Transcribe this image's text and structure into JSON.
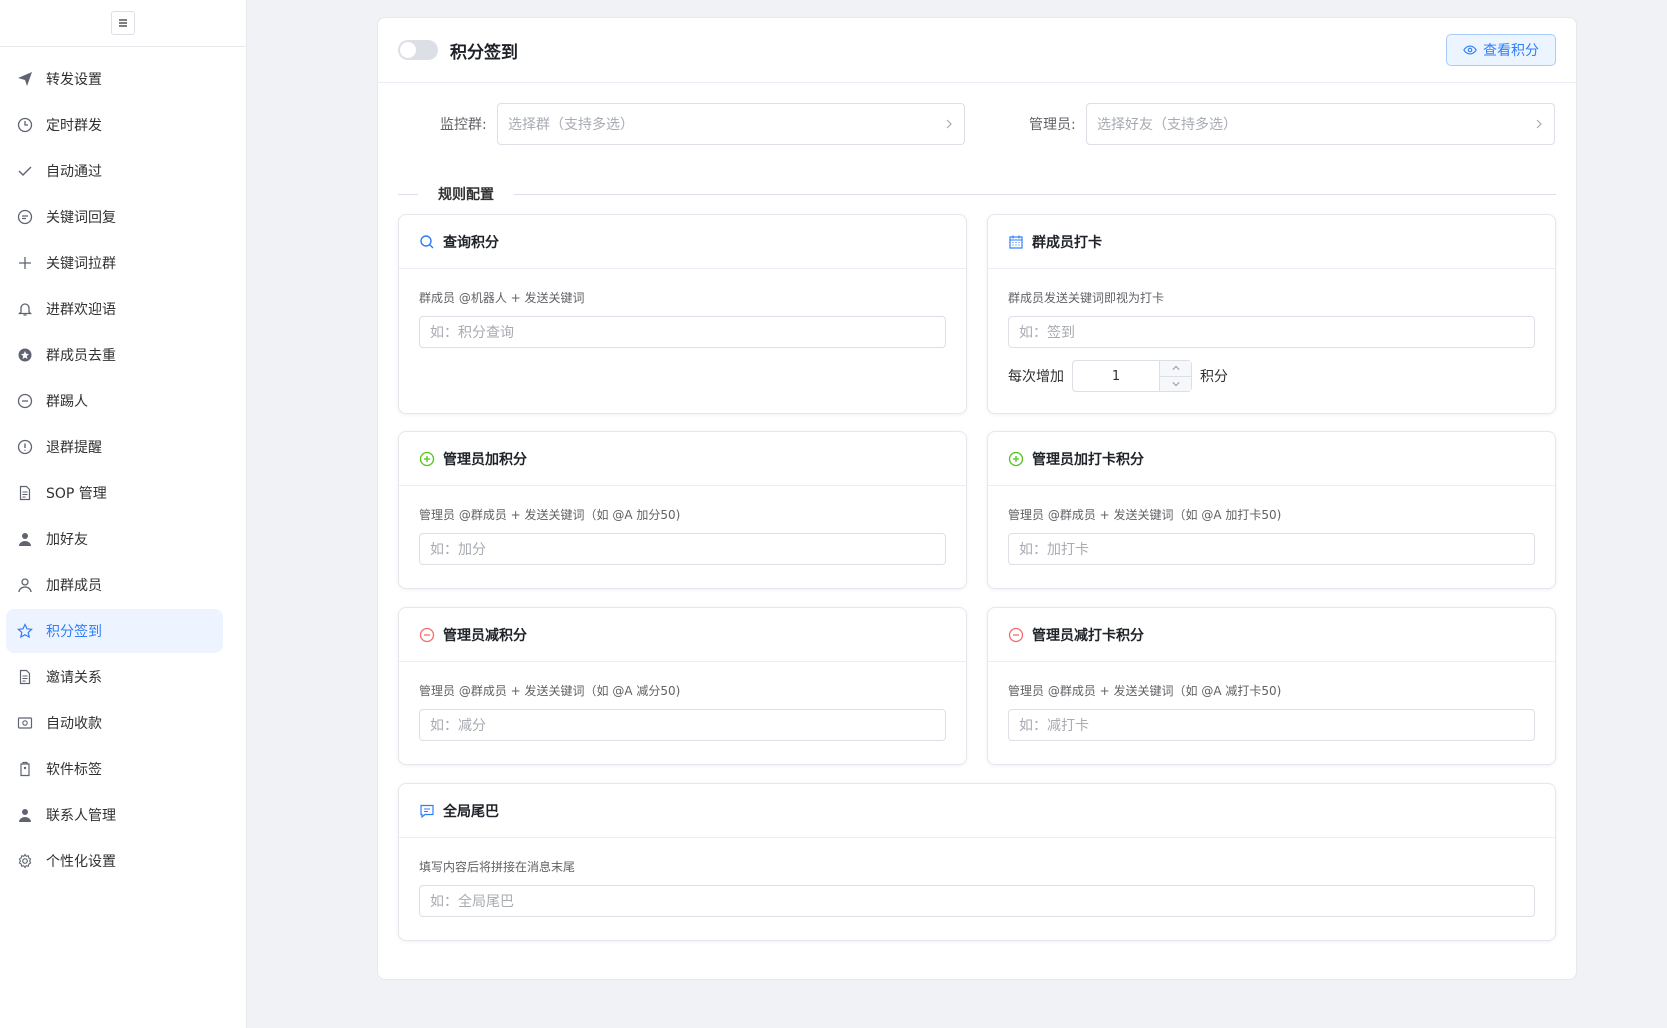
{
  "sidebar": {
    "items": [
      {
        "label": "转发设置",
        "icon": "send-icon"
      },
      {
        "label": "定时群发",
        "icon": "clock-icon"
      },
      {
        "label": "自动通过",
        "icon": "check-icon"
      },
      {
        "label": "关键词回复",
        "icon": "chat-icon"
      },
      {
        "label": "关键词拉群",
        "icon": "plus-icon"
      },
      {
        "label": "进群欢迎语",
        "icon": "bell-icon"
      },
      {
        "label": "群成员去重",
        "icon": "badge-icon"
      },
      {
        "label": "群踢人",
        "icon": "minus-circle-icon"
      },
      {
        "label": "退群提醒",
        "icon": "warning-icon"
      },
      {
        "label": "SOP 管理",
        "icon": "document-icon"
      },
      {
        "label": "加好友",
        "icon": "user-filled-icon"
      },
      {
        "label": "加群成员",
        "icon": "user-icon"
      },
      {
        "label": "积分签到",
        "icon": "star-icon"
      },
      {
        "label": "邀请关系",
        "icon": "document-icon"
      },
      {
        "label": "自动收款",
        "icon": "wallet-icon"
      },
      {
        "label": "软件标签",
        "icon": "tag-icon"
      },
      {
        "label": "联系人管理",
        "icon": "contacts-icon"
      },
      {
        "label": "个性化设置",
        "icon": "gear-icon"
      }
    ],
    "active_index": 12
  },
  "header": {
    "title": "积分签到",
    "view_button": "查看积分",
    "enabled": false
  },
  "filters": {
    "group_label": "监控群:",
    "group_placeholder": "选择群（支持多选）",
    "admin_label": "管理员:",
    "admin_placeholder": "选择好友（支持多选）"
  },
  "divider_title": "规则配置",
  "rules": {
    "query": {
      "title": "查询积分",
      "desc": "群成员 @机器人 + 发送关键词",
      "placeholder": "如：积分查询"
    },
    "checkin": {
      "title": "群成员打卡",
      "desc": "群成员发送关键词即视为打卡",
      "placeholder": "如：签到",
      "step_label": "每次增加",
      "step_value": "1",
      "step_unit": "积分"
    },
    "admin_add": {
      "title": "管理员加积分",
      "desc": "管理员 @群成员 + 发送关键词（如 @A 加分50)",
      "placeholder": "如：加分"
    },
    "admin_add_checkin": {
      "title": "管理员加打卡积分",
      "desc": "管理员 @群成员 + 发送关键词（如 @A 加打卡50)",
      "placeholder": "如：加打卡"
    },
    "admin_sub": {
      "title": "管理员减积分",
      "desc": "管理员 @群成员 + 发送关键词（如 @A 减分50)",
      "placeholder": "如：减分"
    },
    "admin_sub_checkin": {
      "title": "管理员减打卡积分",
      "desc": "管理员 @群成员 + 发送关键词（如 @A 减打卡50)",
      "placeholder": "如：减打卡"
    },
    "tail": {
      "title": "全局尾巴",
      "desc": "填写内容后将拼接在消息末尾",
      "placeholder": "如：全局尾巴"
    }
  },
  "colors": {
    "accent": "#2f7ef8",
    "add": "#52c41a",
    "sub": "#f56c6c"
  }
}
